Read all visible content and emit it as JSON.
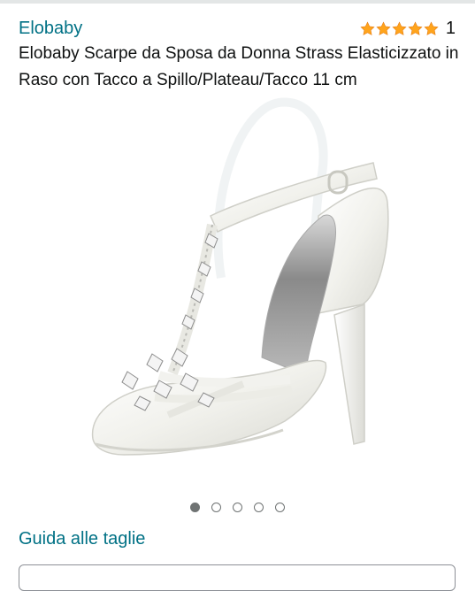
{
  "product": {
    "brand": "Elobaby",
    "rating_count": "1",
    "rating_stars": 5,
    "title": "Elobaby Scarpe da Sposa da Donna Strass Elasticizzato in Raso con Tacco a Spillo/Plateau/Tacco 11 cm"
  },
  "gallery": {
    "image_count": 5,
    "active_index": 0
  },
  "links": {
    "size_guide": "Guida alle taglie"
  },
  "colors": {
    "link": "#007185",
    "star": "#FFA41C",
    "text": "#0F1111"
  }
}
